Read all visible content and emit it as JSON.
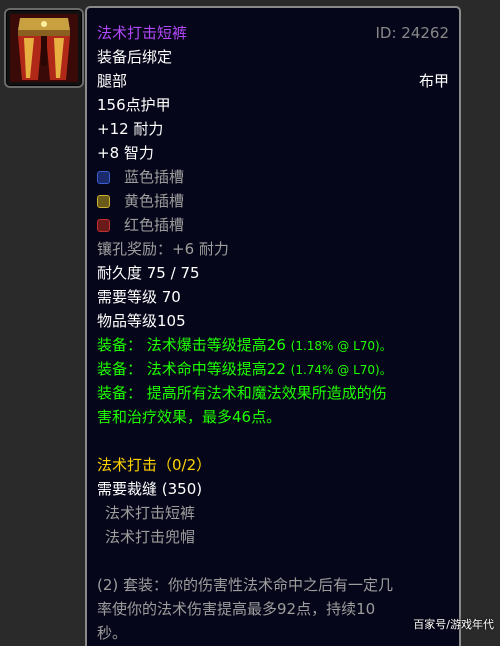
{
  "item": {
    "name": "法术打击短裤",
    "id_label": "ID: 24262",
    "bind": "装备后绑定",
    "slot": "腿部",
    "armor_type": "布甲",
    "armor": "156点护甲",
    "stats": [
      "+12 耐力",
      "+8 智力"
    ],
    "sockets": [
      {
        "label": "蓝色插槽",
        "color": "#3a5fd0"
      },
      {
        "label": "黄色插槽",
        "color": "#d0b030"
      },
      {
        "label": "红色插槽",
        "color": "#c03030"
      }
    ],
    "socket_bonus": "镶孔奖励：+6 耐力",
    "durability": "耐久度 75 / 75",
    "required_level": "需要等级 70",
    "item_level": "物品等级105",
    "equip_effects": [
      {
        "text": "装备： 法术爆击等级提高26",
        "note": "(1.18% @ L70)。"
      },
      {
        "text": "装备： 法术命中等级提高22",
        "note": "(1.74% @ L70)。"
      }
    ],
    "equip_long_1": "装备： 提高所有法术和魔法效果所造成的伤",
    "equip_long_2": "害和治疗效果，最多46点。",
    "set_name": "法术打击（0/2）",
    "set_requirement": "需要裁缝 (350)",
    "set_pieces": [
      "法术打击短裤",
      "法术打击兜帽"
    ],
    "set_bonus_1": "(2) 套装：你的伤害性法术命中之后有一定几",
    "set_bonus_2": "率使你的法术伤害提高最多92点，持续10",
    "set_bonus_3": "秒。"
  },
  "watermark": "百家号/游戏年代",
  "colors": {
    "epic": "#b048f8",
    "green": "#1eff00",
    "gold": "#ffd200",
    "grey": "#9d9d9d"
  },
  "icon": "spellstrike-pants-icon"
}
